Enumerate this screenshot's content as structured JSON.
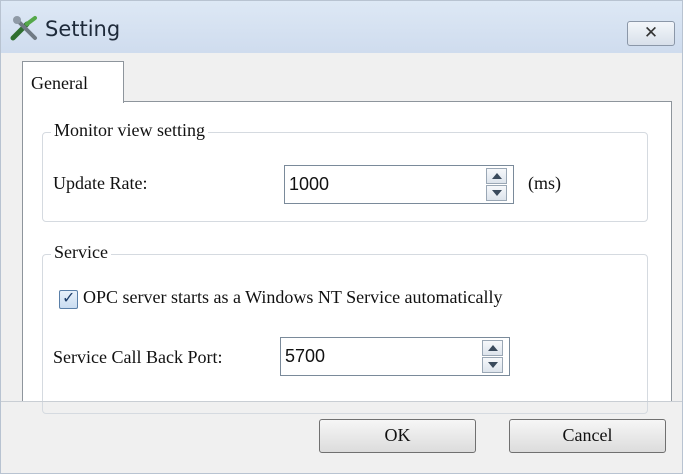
{
  "window": {
    "title": "Setting",
    "close_label": "✕"
  },
  "tabs": [
    {
      "label": "General",
      "active": true
    }
  ],
  "monitor_group": {
    "legend": "Monitor view setting",
    "update_rate_label": "Update Rate:",
    "update_rate_value": "1000",
    "update_rate_unit": "(ms)"
  },
  "service_group": {
    "legend": "Service",
    "checkbox_label": "OPC server starts as a Windows NT Service automatically",
    "checkbox_checked": true,
    "port_label": "Service Call Back Port:",
    "port_value": "5700"
  },
  "buttons": {
    "ok": "OK",
    "cancel": "Cancel"
  },
  "icons": {
    "title": "tools-icon",
    "close": "close-icon",
    "spin_up": "arrow-up-icon",
    "spin_down": "arrow-down-icon",
    "check": "checkmark-icon"
  }
}
